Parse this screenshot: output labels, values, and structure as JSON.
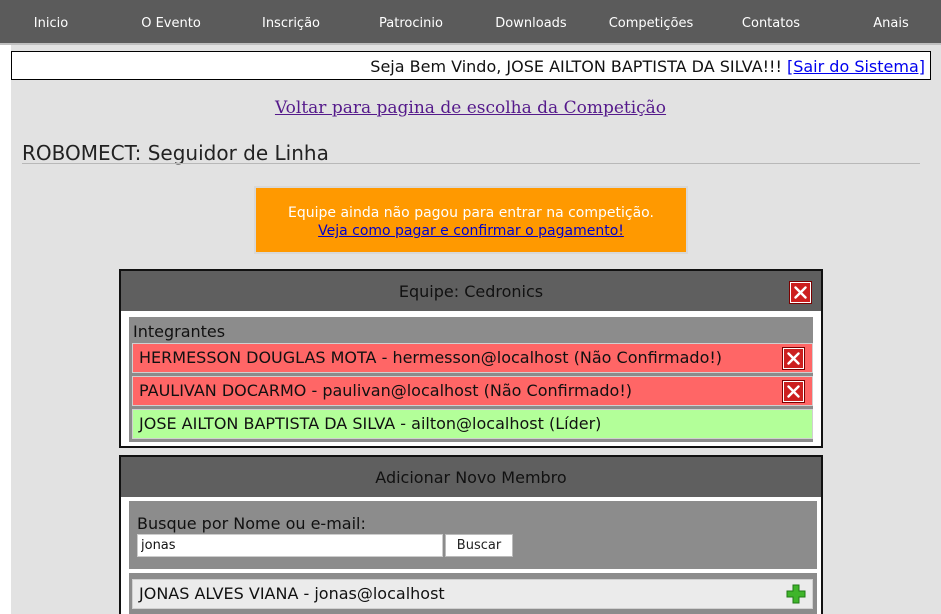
{
  "nav": {
    "items": [
      "Inicio",
      "O Evento",
      "Inscrição",
      "Patrocinio",
      "Downloads",
      "Competições",
      "Contatos",
      "Anais"
    ]
  },
  "welcome": {
    "greeting": "Seja Bem Vindo, JOSE AILTON BAPTISTA DA SILVA!!!",
    "logout_label": "[Sair do Sistema]"
  },
  "back_link": "Voltar para pagina de escolha da Competição",
  "page_title": "ROBOMECT: Seguidor de Linha",
  "payment_notice": {
    "message": "Equipe ainda não pagou para entrar na competição.",
    "link": "Veja como pagar e confirmar o pagamento!",
    "color": "#ff9900"
  },
  "team": {
    "title": "Equipe: Cedronics",
    "members_label": "Integrantes",
    "members": [
      {
        "text": "HERMESSON DOUGLAS MOTA - hermesson@localhost (Não Confirmado!)",
        "status": "pending"
      },
      {
        "text": "PAULIVAN DOCARMO - paulivan@localhost (Não Confirmado!)",
        "status": "pending"
      },
      {
        "text": "JOSE AILTON BAPTISTA DA SILVA - ailton@localhost (Líder)",
        "status": "leader"
      }
    ],
    "colors": {
      "pending": "#ff6666",
      "leader": "#b3ff99"
    }
  },
  "add_member": {
    "title": "Adicionar Novo Membro",
    "search_label": "Busque por Nome ou e-mail:",
    "search_value": "jonas",
    "search_button": "Buscar",
    "results": [
      {
        "text": "JONAS ALVES VIANA - jonas@localhost"
      }
    ]
  },
  "icons": {
    "remove": "close-icon",
    "add": "plus-icon"
  }
}
